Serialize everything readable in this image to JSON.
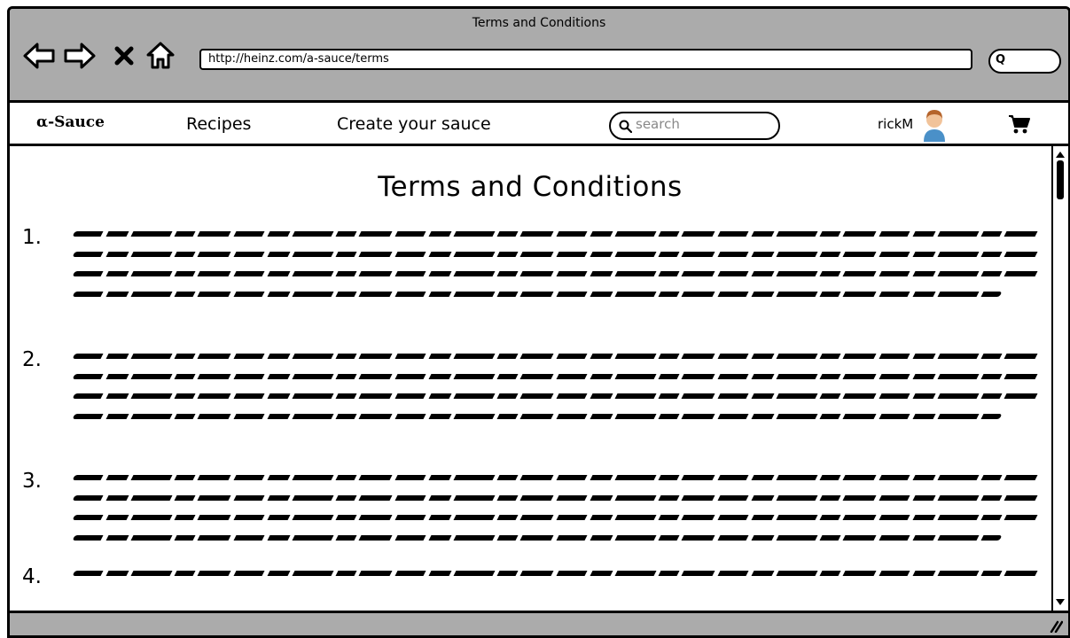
{
  "window": {
    "title": "Terms and Conditions"
  },
  "browser": {
    "address": "http://heinz.com/a-sauce/terms",
    "search_glyph": "Q",
    "icons": [
      "back-arrow-icon",
      "forward-arrow-icon",
      "close-icon",
      "home-icon",
      "search-icon"
    ]
  },
  "nav": {
    "brand": "α-Sauce",
    "recipes": "Recipes",
    "create": "Create your sauce",
    "search_placeholder": "search",
    "user": "rickM",
    "cart_icon": "cart-icon",
    "avatar_icon": "avatar-icon"
  },
  "page": {
    "heading": "Terms and Conditions",
    "terms": [
      {
        "number": "1."
      },
      {
        "number": "2."
      },
      {
        "number": "3."
      },
      {
        "number": "4."
      }
    ]
  }
}
